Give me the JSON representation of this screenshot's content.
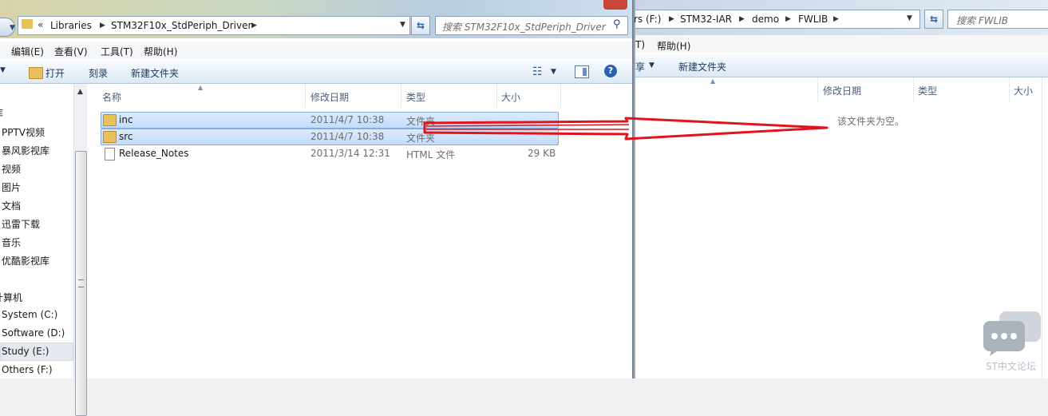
{
  "left_window": {
    "address": {
      "overflow": "«",
      "crumbs": [
        "Libraries",
        "STM32F10x_StdPeriph_Driver"
      ]
    },
    "search_placeholder": "搜索 STM32F10x_StdPeriph_Driver",
    "menu": [
      "编辑(E)",
      "查看(V)",
      "工具(T)",
      "帮助(H)"
    ],
    "toolbar": {
      "open": "打开",
      "burn": "刻录",
      "new_folder": "新建文件夹"
    },
    "nav": {
      "items": [
        "库",
        "PPTV视频",
        "暴风影视库",
        "视频",
        "图片",
        "文档",
        "迅雷下载",
        "音乐",
        "优酷影视库",
        "计算机",
        "System (C:)",
        "Software (D:)",
        "Study (E:)",
        "Others (F:)"
      ]
    },
    "columns": {
      "name": "名称",
      "date": "修改日期",
      "type": "类型",
      "size": "大小"
    },
    "files": [
      {
        "name": "inc",
        "date": "2011/4/7 10:38",
        "type": "文件夹",
        "size": "",
        "kind": "folder",
        "selected": true
      },
      {
        "name": "src",
        "date": "2011/4/7 10:38",
        "type": "文件夹",
        "size": "",
        "kind": "folder",
        "selected": true
      },
      {
        "name": "Release_Notes",
        "date": "2011/3/14 12:31",
        "type": "HTML 文件",
        "size": "29 KB",
        "kind": "file",
        "selected": false
      }
    ]
  },
  "right_window": {
    "address": {
      "crumbs": [
        "rs (F:)",
        "STM32-IAR",
        "demo",
        "FWLIB"
      ]
    },
    "search_placeholder": "搜索 FWLIB",
    "menu": [
      "T)",
      "帮助(H)"
    ],
    "toolbar": {
      "share": "享",
      "new_folder": "新建文件夹"
    },
    "columns": {
      "date": "修改日期",
      "type": "类型",
      "size": "大小"
    },
    "empty_message": "该文件夹为空。"
  },
  "annotation": {
    "color": "#e0141c"
  },
  "watermark": {
    "text": "ST中文论坛"
  }
}
